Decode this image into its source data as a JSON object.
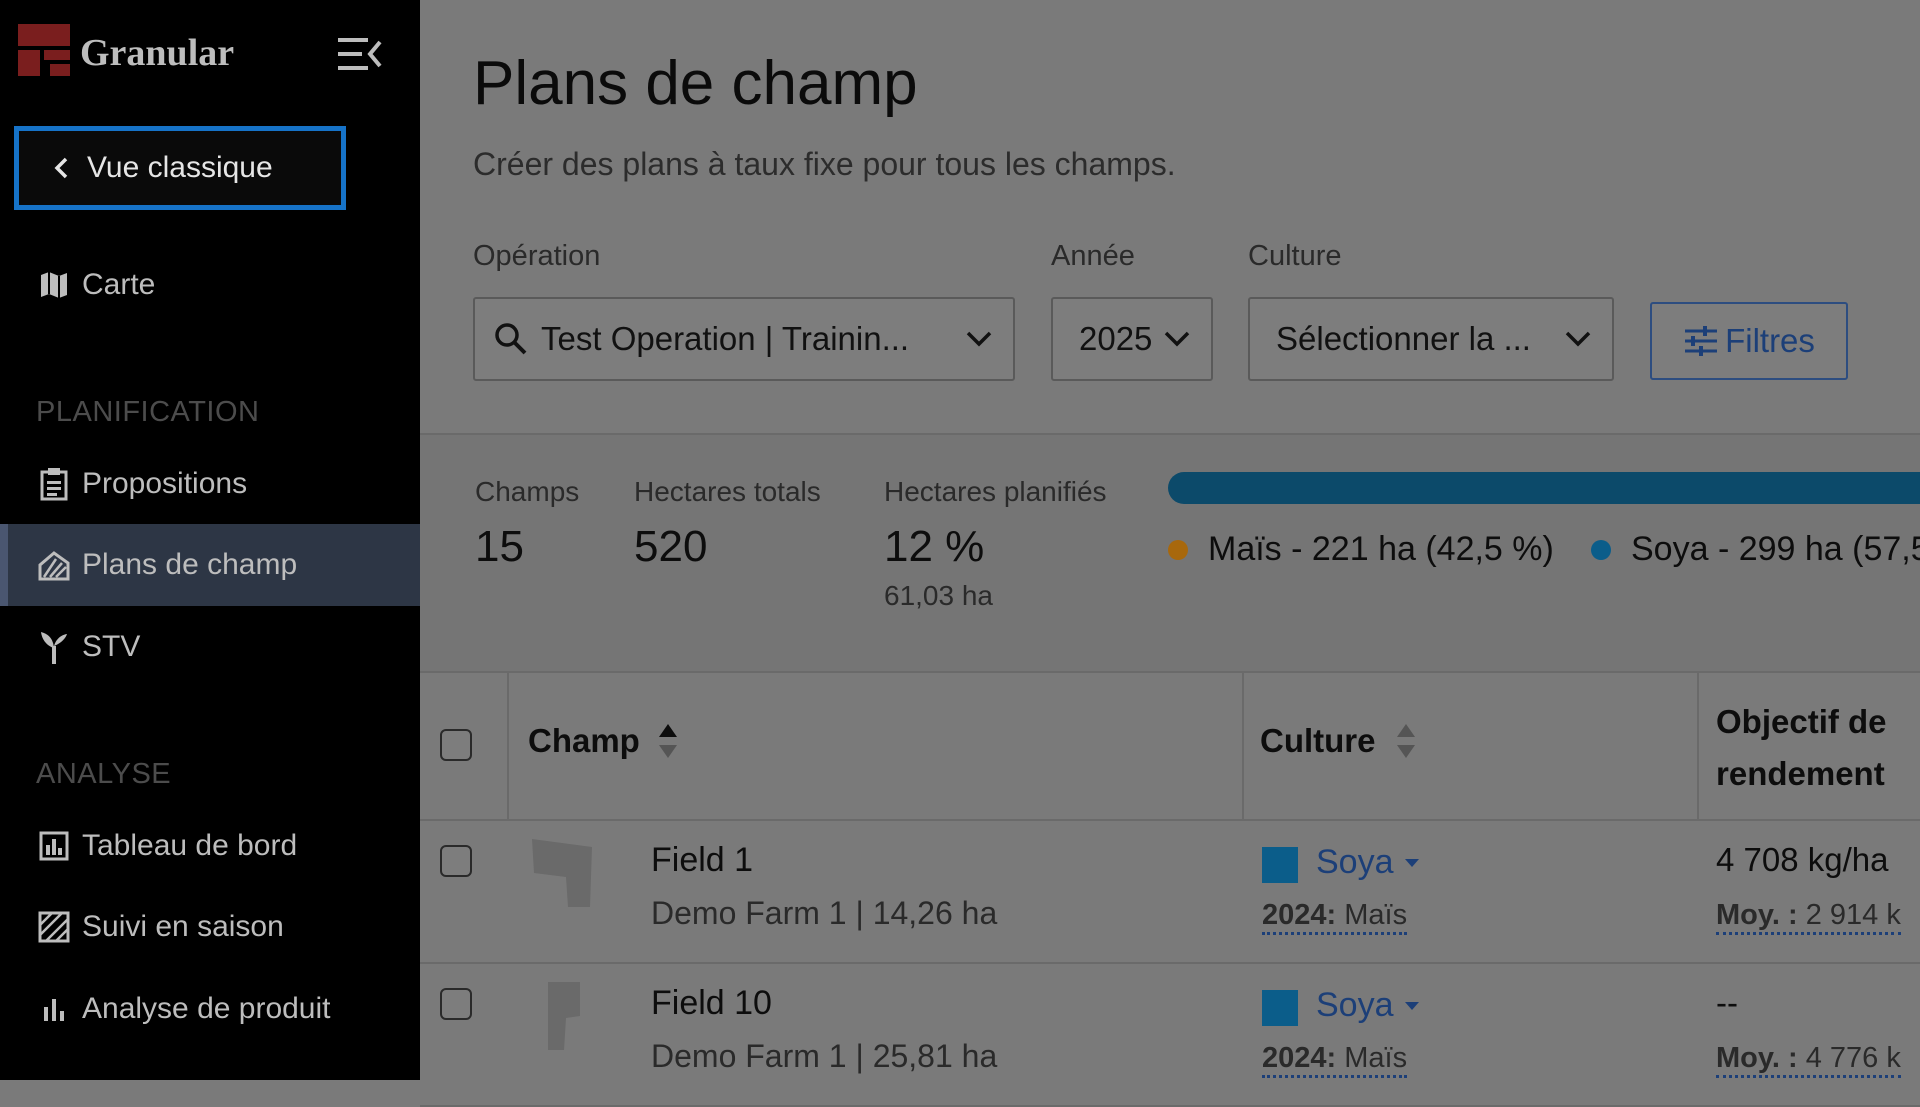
{
  "app": {
    "logo_text": "Granular"
  },
  "sidebar": {
    "classic_view_label": "Vue classique",
    "map_label": "Carte",
    "section_planning": "PLANIFICATION",
    "section_analysis": "ANALYSE",
    "items": [
      {
        "label": "Propositions",
        "icon": "clipboard-icon"
      },
      {
        "label": "Plans de champ",
        "icon": "field-plan-icon",
        "active": true
      },
      {
        "label": "STV",
        "icon": "sprout-icon"
      },
      {
        "label": "Tableau de bord",
        "icon": "dashboard-icon"
      },
      {
        "label": "Suivi en saison",
        "icon": "season-tracking-icon"
      },
      {
        "label": "Analyse de produit",
        "icon": "bar-chart-icon"
      }
    ]
  },
  "header": {
    "title": "Plans de champ",
    "subtitle": "Créer des plans à taux fixe pour tous les champs."
  },
  "filters": {
    "operation_label": "Opération",
    "operation_value": "Test Operation | Trainin...",
    "year_label": "Année",
    "year_value": "2025",
    "crop_label": "Culture",
    "crop_value": "Sélectionner la ...",
    "filters_button": "Filtres"
  },
  "stats": {
    "fields_label": "Champs",
    "fields_value": "15",
    "total_ha_label": "Hectares totals",
    "total_ha_value": "520",
    "planned_label": "Hectares planifiés",
    "planned_value": "12 %",
    "planned_sub": "61,03 ha",
    "planned_fraction": 0.12,
    "legend": [
      {
        "label": "Maïs - 221 ha (42,5 %)",
        "color": "#a8680c"
      },
      {
        "label": "Soya - 299 ha (57,5",
        "color": "#0b5d8a"
      }
    ]
  },
  "table": {
    "headers": {
      "field": "Champ",
      "crop": "Culture",
      "yield_line1": "Objectif de",
      "yield_line2": "rendement"
    },
    "rows": [
      {
        "name": "Field 1",
        "sub": "Demo Farm 1 | 14,26 ha",
        "crop": "Soya",
        "prev_year": "2024:",
        "prev_crop": "Maïs",
        "yield": "4 708 kg/ha",
        "avg_label": "Moy. :",
        "avg_value": "2 914 k"
      },
      {
        "name": "Field 10",
        "sub": "Demo Farm 1 | 25,81 ha",
        "crop": "Soya",
        "prev_year": "2024:",
        "prev_crop": "Maïs",
        "yield": "--",
        "avg_label": "Moy. :",
        "avg_value": "4 776 k"
      }
    ]
  },
  "colors": {
    "accent_blue": "#1673c8",
    "link_blue": "#1c3f78",
    "progress_blue": "#0c4a6a",
    "corn_orange": "#a8680c",
    "soy_blue": "#0b5d8a"
  }
}
